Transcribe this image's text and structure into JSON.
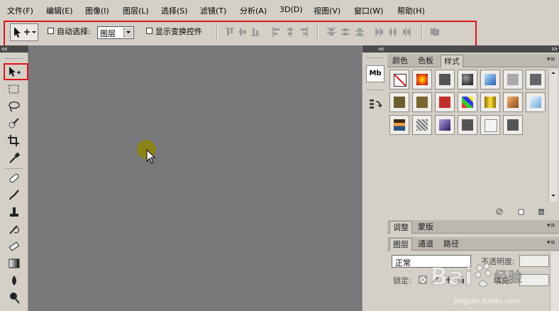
{
  "menu": [
    "文件(F)",
    "编辑(E)",
    "图像(I)",
    "图层(L)",
    "选择(S)",
    "滤镜(T)",
    "分析(A)",
    "3D(D)",
    "视图(V)",
    "窗口(W)",
    "帮助(H)"
  ],
  "options_bar": {
    "auto_select_label": "自动选择:",
    "auto_select_value": "图层",
    "show_transform_label": "显示变换控件"
  },
  "panels": {
    "top_tabs": [
      "颜色",
      "色板",
      "样式"
    ],
    "active_top_tab": "样式",
    "adjust_tabs": [
      "调整",
      "蒙版"
    ],
    "layer_tabs": [
      "图层",
      "通道",
      "路径"
    ],
    "blend_mode": "正常",
    "opacity_label": "不透明度:",
    "lock_label": "锁定:",
    "fill_label": "填充:"
  },
  "dock": {
    "mb_label": "Mb"
  },
  "watermark": {
    "brand_text": "Bai",
    "brand_text2": "经验",
    "url": "jingyan.baidu.com"
  },
  "colors": {
    "highlight": "#e0141a",
    "canvas": "#78777a",
    "chrome": "#d4d0c8",
    "cursor_dot": "#8c8410"
  }
}
